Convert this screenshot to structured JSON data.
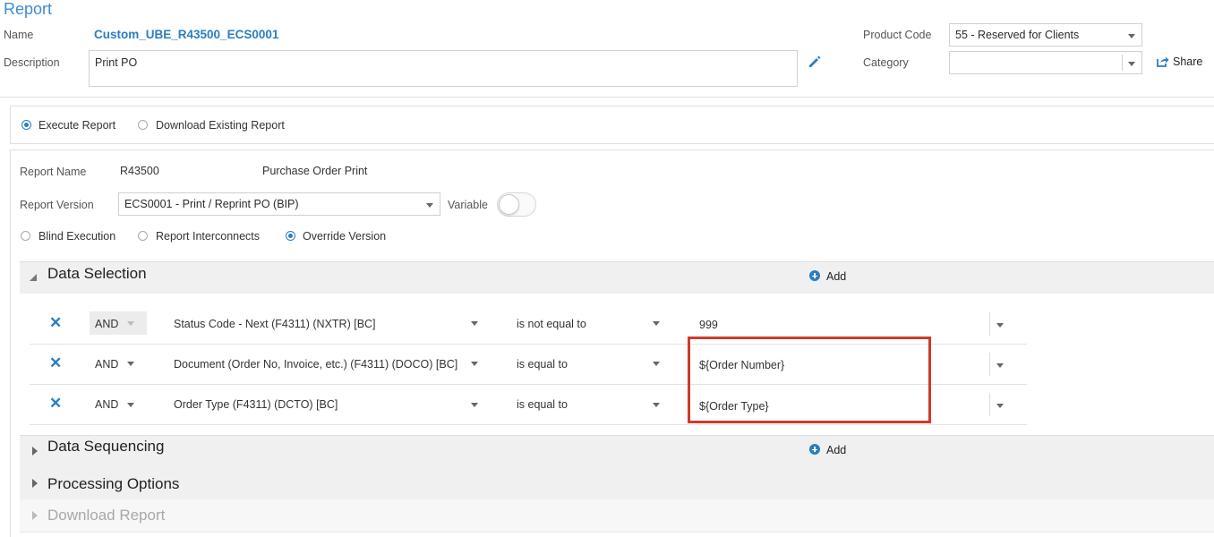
{
  "header": {
    "title": "Report",
    "name_label": "Name",
    "name_value": "Custom_UBE_R43500_ECS0001",
    "description_label": "Description",
    "description_value": "Print PO",
    "product_code_label": "Product Code",
    "product_code_value": "55 - Reserved for Clients",
    "category_label": "Category",
    "category_value": "",
    "share_label": "Share"
  },
  "mode": {
    "execute_label": "Execute Report",
    "download_existing_label": "Download Existing Report",
    "selected": "execute"
  },
  "report": {
    "name_label": "Report Name",
    "name_value": "R43500",
    "name_desc": "Purchase Order Print",
    "version_label": "Report Version",
    "version_value": "ECS0001 - Print / Reprint PO (BIP)",
    "variable_label": "Variable",
    "options": {
      "blind": "Blind Execution",
      "interconnects": "Report Interconnects",
      "override": "Override Version",
      "selected": "override"
    }
  },
  "data_selection": {
    "title": "Data Selection",
    "add_label": "Add",
    "rows": [
      {
        "andor": "AND",
        "field": "Status Code - Next (F4311) (NXTR) [BC]",
        "operator": "is not equal to",
        "value": "999"
      },
      {
        "andor": "AND",
        "field": "Document (Order No, Invoice, etc.) (F4311) (DOCO) [BC]",
        "operator": "is equal to",
        "value": "${Order Number}"
      },
      {
        "andor": "AND",
        "field": "Order Type (F4311) (DCTO) [BC]",
        "operator": "is equal to",
        "value": "${Order Type}"
      }
    ]
  },
  "data_sequencing": {
    "title": "Data Sequencing",
    "add_label": "Add"
  },
  "processing_options": {
    "title": "Processing Options"
  },
  "download_report": {
    "title": "Download Report"
  },
  "colors": {
    "accent": "#2a7ec0",
    "highlight": "#d03a2a"
  }
}
